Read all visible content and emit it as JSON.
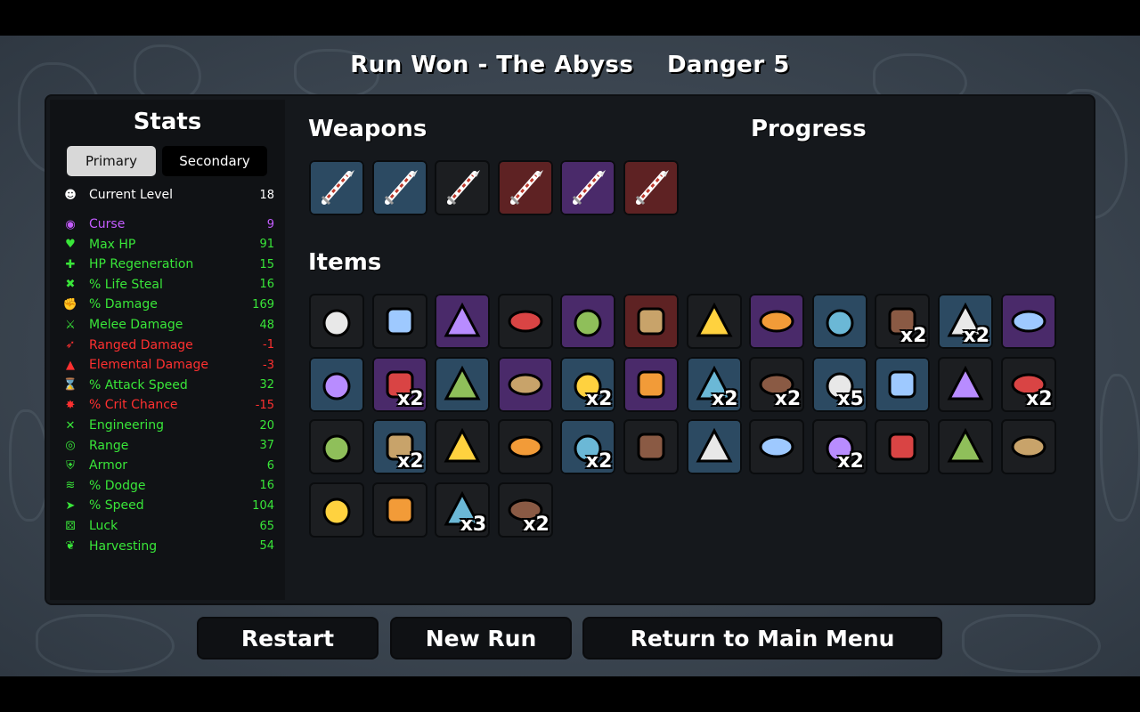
{
  "header": {
    "title": "Run Won - The Abyss",
    "danger": "Danger 5"
  },
  "stats": {
    "title": "Stats",
    "tabs": {
      "primary": "Primary",
      "secondary": "Secondary"
    },
    "active_tab": "Primary",
    "current_level": {
      "label": "Current Level",
      "value": "18"
    },
    "rows": [
      {
        "label": "Curse",
        "value": "9",
        "color": "#c45cff",
        "icon": "curse-icon",
        "glyph": "◉"
      },
      {
        "label": "Max HP",
        "value": "91",
        "color": "#39e639",
        "icon": "heart-icon",
        "glyph": "♥"
      },
      {
        "label": "HP Regeneration",
        "value": "15",
        "color": "#39e639",
        "icon": "heart-plus-icon",
        "glyph": "✚"
      },
      {
        "label": "% Life Steal",
        "value": "16",
        "color": "#39e639",
        "icon": "fangs-icon",
        "glyph": "✖"
      },
      {
        "label": "% Damage",
        "value": "169",
        "color": "#39e639",
        "icon": "muscle-icon",
        "glyph": "✊"
      },
      {
        "label": "Melee Damage",
        "value": "48",
        "color": "#39e639",
        "icon": "sword-icon",
        "glyph": "⚔"
      },
      {
        "label": "Ranged Damage",
        "value": "-1",
        "color": "#ff3030",
        "icon": "bow-icon",
        "glyph": "➶"
      },
      {
        "label": "Elemental Damage",
        "value": "-3",
        "color": "#ff3030",
        "icon": "fire-icon",
        "glyph": "▲"
      },
      {
        "label": "% Attack Speed",
        "value": "32",
        "color": "#39e639",
        "icon": "hourglass-icon",
        "glyph": "⌛"
      },
      {
        "label": "% Crit Chance",
        "value": "-15",
        "color": "#ff3030",
        "icon": "crit-icon",
        "glyph": "✸"
      },
      {
        "label": "Engineering",
        "value": "20",
        "color": "#39e639",
        "icon": "wrench-icon",
        "glyph": "✕"
      },
      {
        "label": "Range",
        "value": "37",
        "color": "#39e639",
        "icon": "range-icon",
        "glyph": "◎"
      },
      {
        "label": "Armor",
        "value": "6",
        "color": "#39e639",
        "icon": "shield-icon",
        "glyph": "⛨"
      },
      {
        "label": "% Dodge",
        "value": "16",
        "color": "#39e639",
        "icon": "dodge-icon",
        "glyph": "≋"
      },
      {
        "label": "% Speed",
        "value": "104",
        "color": "#39e639",
        "icon": "boot-icon",
        "glyph": "➤"
      },
      {
        "label": "Luck",
        "value": "65",
        "color": "#39e639",
        "icon": "dice-icon",
        "glyph": "⚄"
      },
      {
        "label": "Harvesting",
        "value": "54",
        "color": "#39e639",
        "icon": "wheat-icon",
        "glyph": "❦"
      }
    ]
  },
  "weapons": {
    "title": "Weapons",
    "slots": [
      {
        "tier": "tier-2",
        "bg": "#2c4a62",
        "icon": "spear-icon"
      },
      {
        "tier": "tier-2",
        "bg": "#2c4a62",
        "icon": "spear-icon"
      },
      {
        "tier": "tier-1",
        "bg": "#1c1e21",
        "icon": "spear-icon"
      },
      {
        "tier": "tier-4",
        "bg": "#5e2223",
        "icon": "spear-icon"
      },
      {
        "tier": "tier-3",
        "bg": "#4a2a6a",
        "icon": "spear-icon"
      },
      {
        "tier": "tier-4",
        "bg": "#5e2223",
        "icon": "spear-icon"
      }
    ]
  },
  "progress": {
    "title": "Progress"
  },
  "items": {
    "title": "Items",
    "slots": [
      {
        "icon": "ghost-beanie-icon",
        "bg": "#1c1e21",
        "qty": ""
      },
      {
        "icon": "butterfly-icon",
        "bg": "#1c1e21",
        "qty": ""
      },
      {
        "icon": "potion-key-icon",
        "bg": "#4a2a6a",
        "qty": ""
      },
      {
        "icon": "syringe-icon",
        "bg": "#1c1e21",
        "qty": ""
      },
      {
        "icon": "beetle-icon",
        "bg": "#4a2a6a",
        "qty": ""
      },
      {
        "icon": "spider-robot-icon",
        "bg": "#5e2223",
        "qty": ""
      },
      {
        "icon": "glasses-icon",
        "bg": "#1c1e21",
        "qty": ""
      },
      {
        "icon": "goldfish-icon",
        "bg": "#4a2a6a",
        "qty": ""
      },
      {
        "icon": "alert-creature-icon",
        "bg": "#2c4a62",
        "qty": ""
      },
      {
        "icon": "duck-icon",
        "bg": "#1c1e21",
        "qty": "x2"
      },
      {
        "icon": "bullet-icon",
        "bg": "#2c4a62",
        "qty": "x2"
      },
      {
        "icon": "mirror-icon",
        "bg": "#4a2a6a",
        "qty": ""
      },
      {
        "icon": "green-machine-icon",
        "bg": "#2c4a62",
        "qty": ""
      },
      {
        "icon": "shark-fin-icon",
        "bg": "#4a2a6a",
        "qty": "x2"
      },
      {
        "icon": "bark-icon",
        "bg": "#2c4a62",
        "qty": ""
      },
      {
        "icon": "bowler-hat-icon",
        "bg": "#4a2a6a",
        "qty": ""
      },
      {
        "icon": "spyglass-icon",
        "bg": "#2c4a62",
        "qty": "x2"
      },
      {
        "icon": "jellyfish-icon",
        "bg": "#4a2a6a",
        "qty": ""
      },
      {
        "icon": "wasp-icon",
        "bg": "#2c4a62",
        "qty": "x2"
      },
      {
        "icon": "helmet-icon",
        "bg": "#1c1e21",
        "qty": "x2"
      },
      {
        "icon": "coin-icon",
        "bg": "#2c4a62",
        "qty": "x5"
      },
      {
        "icon": "claws-icon",
        "bg": "#2c4a62",
        "qty": ""
      },
      {
        "icon": "purple-syringe-icon",
        "bg": "#1c1e21",
        "qty": ""
      },
      {
        "icon": "hedgehog-icon",
        "bg": "#1c1e21",
        "qty": "x2"
      },
      {
        "icon": "goat-skull-icon",
        "bg": "#1c1e21",
        "qty": ""
      },
      {
        "icon": "red-cape-icon",
        "bg": "#2c4a62",
        "qty": "x2"
      },
      {
        "icon": "skull-tooth-icon",
        "bg": "#1c1e21",
        "qty": ""
      },
      {
        "icon": "mask-icon",
        "bg": "#1c1e21",
        "qty": ""
      },
      {
        "icon": "stone-icon",
        "bg": "#2c4a62",
        "qty": "x2"
      },
      {
        "icon": "whistle-icon",
        "bg": "#1c1e21",
        "qty": ""
      },
      {
        "icon": "jar-icon",
        "bg": "#2c4a62",
        "qty": ""
      },
      {
        "icon": "lizard-icon",
        "bg": "#1c1e21",
        "qty": ""
      },
      {
        "icon": "propeller-hat-icon",
        "bg": "#1c1e21",
        "qty": "x2"
      },
      {
        "icon": "money-icon",
        "bg": "#1c1e21",
        "qty": ""
      },
      {
        "icon": "cake-icon",
        "bg": "#1c1e21",
        "qty": ""
      },
      {
        "icon": "cat-icon",
        "bg": "#1c1e21",
        "qty": ""
      },
      {
        "icon": "tree-icon",
        "bg": "#1c1e21",
        "qty": ""
      },
      {
        "icon": "coal-icon",
        "bg": "#1c1e21",
        "qty": ""
      },
      {
        "icon": "monkey-icon",
        "bg": "#1c1e21",
        "qty": "x3"
      },
      {
        "icon": "red-branch-icon",
        "bg": "#1c1e21",
        "qty": "x2"
      }
    ]
  },
  "buttons": {
    "restart": "Restart",
    "new_run": "New Run",
    "main_menu": "Return to Main Menu"
  }
}
